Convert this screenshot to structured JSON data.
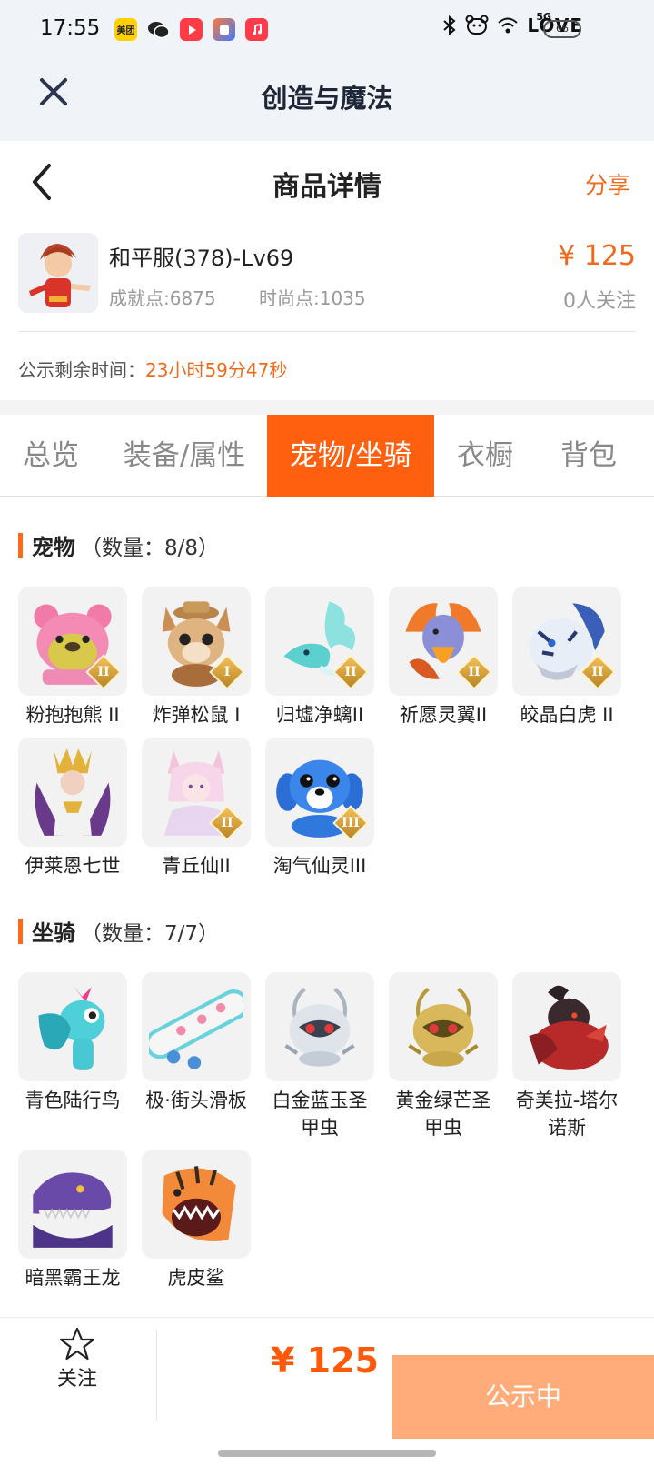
{
  "status_bar": {
    "time": "17:55",
    "apps": [
      {
        "icon": "meituan-app-icon",
        "text": "美团",
        "color": "#ffd100"
      },
      {
        "icon": "wechat-app-icon",
        "text": "",
        "color": "#ffffff"
      },
      {
        "icon": "video-app-icon",
        "text": "",
        "color": "#ff3b45"
      },
      {
        "icon": "shortcut-app-icon",
        "text": "",
        "color": "#3b7bff"
      },
      {
        "icon": "music-app-icon",
        "text": "",
        "color": "#ff3a4a"
      }
    ],
    "love_badge": "LOVE",
    "network_label": "5G",
    "battery": "66"
  },
  "webview": {
    "title": "创造与魔法",
    "close_icon": "close-icon"
  },
  "header": {
    "title": "商品详情",
    "share": "分享"
  },
  "role": {
    "name": "和平服(378)-Lv69",
    "achievement": "成就点:6875",
    "fashion": "时尚点:1035",
    "price": "¥ 125",
    "followers": "0人关注",
    "countdown_label": "公示剩余时间：",
    "countdown_value": "23小时59分47秒"
  },
  "tabs": [
    {
      "label": "总览",
      "active": false
    },
    {
      "label": "装备/属性",
      "active": false
    },
    {
      "label": "宠物/坐骑",
      "active": true
    },
    {
      "label": "衣橱",
      "active": false
    },
    {
      "label": "背包",
      "active": false
    }
  ],
  "pets": {
    "title": "宠物",
    "count": "（数量：8/8）",
    "items": [
      {
        "name": "粉抱抱熊 II",
        "rank": "II",
        "icon": "pink-bear-icon"
      },
      {
        "name": "炸弹松鼠 I",
        "rank": "I",
        "icon": "bomb-squirrel-icon"
      },
      {
        "name": "归墟净螭II",
        "rank": "II",
        "icon": "jade-dragon-icon"
      },
      {
        "name": "祈愿灵翼II",
        "rank": "II",
        "icon": "spirit-bird-icon"
      },
      {
        "name": "皎晶白虎 II",
        "rank": "II",
        "icon": "white-tiger-icon"
      },
      {
        "name": "伊莱恩七世",
        "rank": "",
        "icon": "queen-figure-icon"
      },
      {
        "name": "青丘仙II",
        "rank": "II",
        "icon": "fox-fairy-icon"
      },
      {
        "name": "淘气仙灵III",
        "rank": "III",
        "icon": "blue-puppy-icon"
      }
    ]
  },
  "mounts": {
    "title": "坐骑",
    "count": "（数量：7/7）",
    "items": [
      {
        "name": "青色陆行鸟",
        "icon": "cyan-bird-icon"
      },
      {
        "name": "极·街头滑板",
        "icon": "skateboard-icon"
      },
      {
        "name": "白金蓝玉圣甲虫",
        "icon": "silver-beetle-icon"
      },
      {
        "name": "黄金绿芒圣甲虫",
        "icon": "gold-beetle-icon"
      },
      {
        "name": "奇美拉-塔尔诺斯",
        "icon": "chimera-icon"
      },
      {
        "name": "暗黑霸王龙",
        "icon": "dark-trex-icon"
      },
      {
        "name": "虎皮鲨",
        "icon": "tiger-shark-icon"
      }
    ]
  },
  "bottom_bar": {
    "follow_label": "关注",
    "price": "¥ 125",
    "cta": "公示中"
  }
}
